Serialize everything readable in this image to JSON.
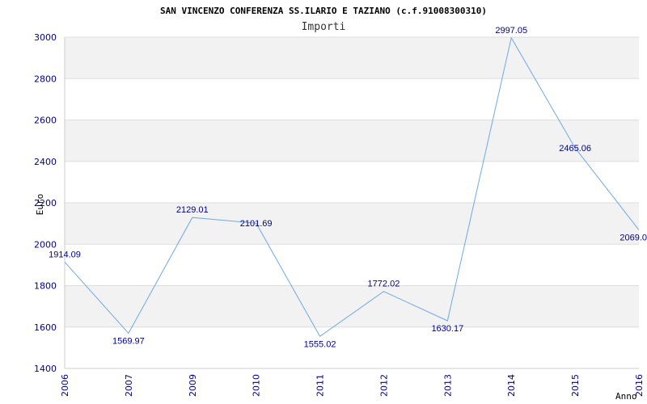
{
  "chart_data": {
    "type": "line",
    "title": "SAN VINCENZO CONFERENZA SS.ILARIO E TAZIANO (c.f.91008300310)",
    "subtitle": "Importi",
    "xlabel": "Anno",
    "ylabel": "Euro",
    "categories": [
      "2006",
      "2007",
      "2009",
      "2010",
      "2011",
      "2012",
      "2013",
      "2014",
      "2015",
      "2016"
    ],
    "values": [
      1914.09,
      1569.97,
      2129.01,
      2101.69,
      1555.02,
      1772.02,
      1630.17,
      2997.05,
      2465.06,
      2069.0
    ],
    "data_labels": [
      "1914.09",
      "1569.97",
      "2129.01",
      "2101.69",
      "1555.02",
      "1772.02",
      "1630.17",
      "2997.05",
      "2465.06",
      "2069.0"
    ],
    "ylim": [
      1400,
      3000
    ],
    "yticks": [
      "1400",
      "1600",
      "1800",
      "2000",
      "2200",
      "2400",
      "2600",
      "2800",
      "3000"
    ],
    "grid": true,
    "legend": "none",
    "colors": {
      "line": "#6fa8e8",
      "ticks": "#00008b",
      "band": "#f2f2f2",
      "grid": "#dddddd"
    }
  }
}
